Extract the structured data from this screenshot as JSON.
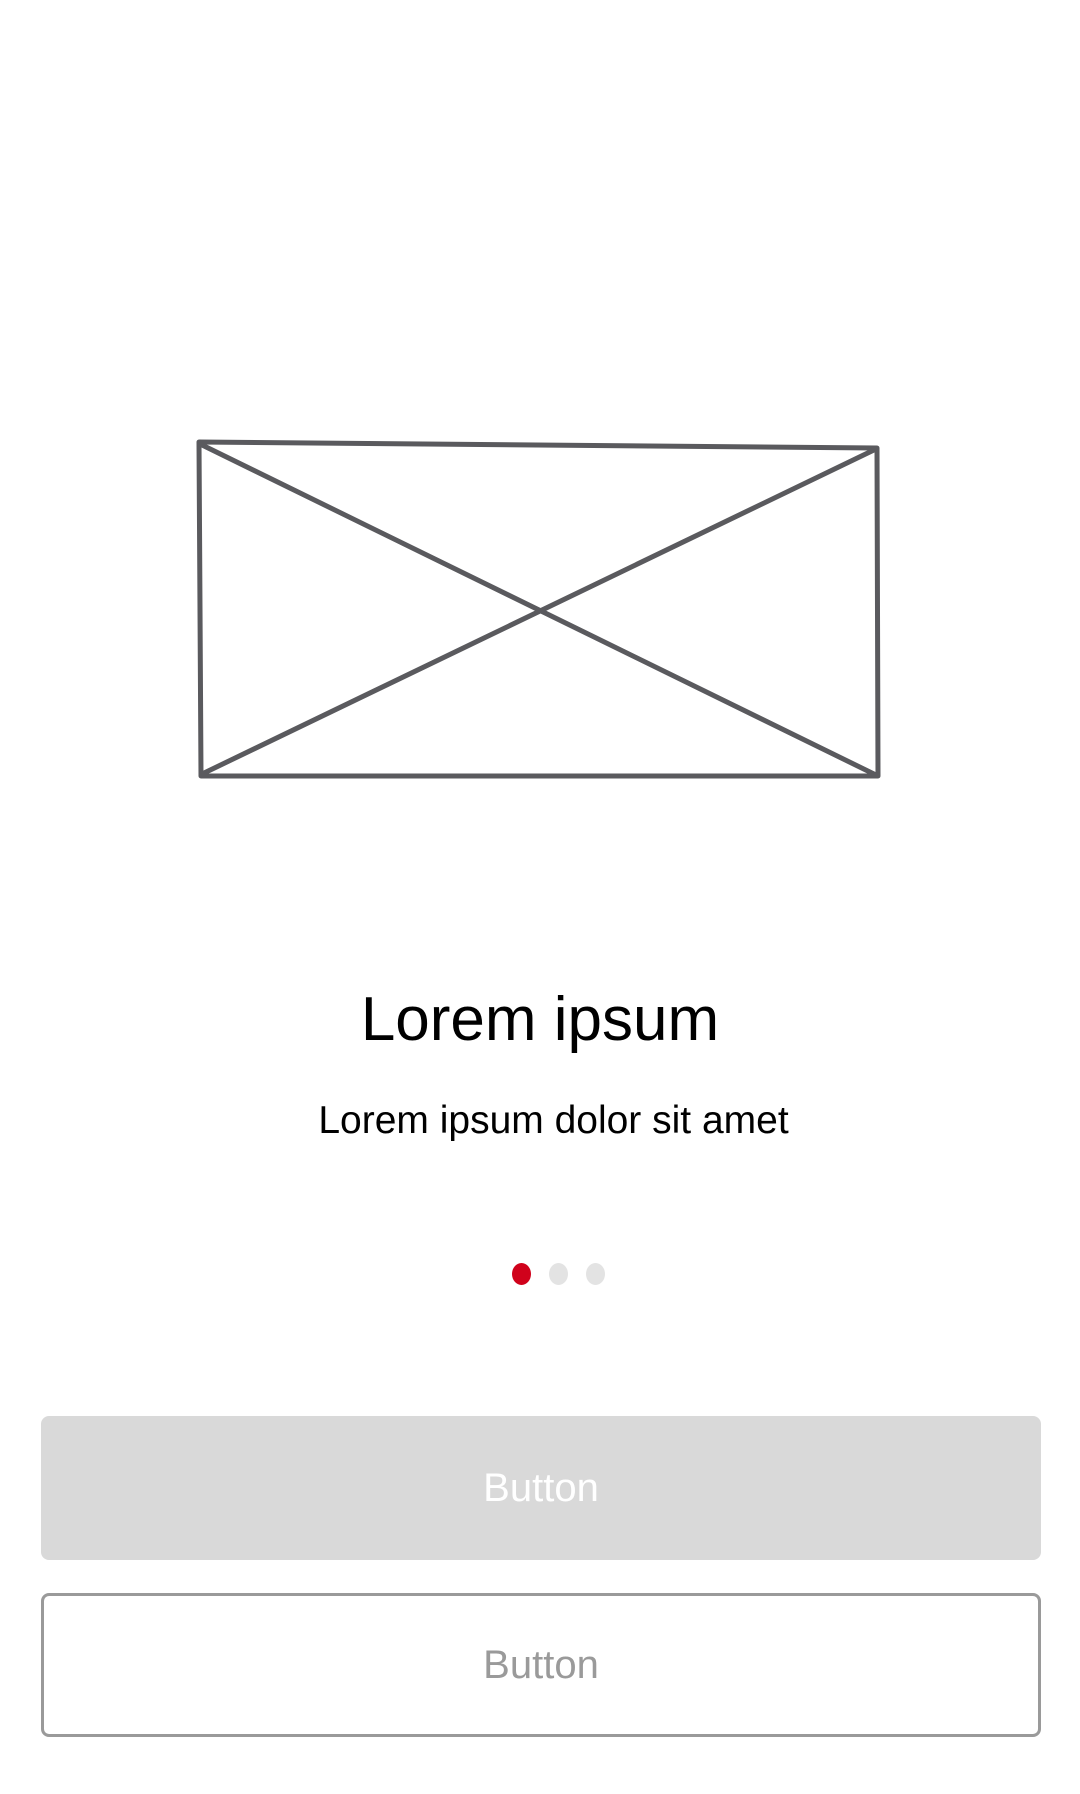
{
  "onboarding": {
    "title": "Lorem ipsum",
    "subtitle": "Lorem ipsum dolor sit amet"
  },
  "pager": {
    "current_page": 1,
    "dots": [
      {
        "color": "#d0021b"
      },
      {
        "color": "#e3e3e3"
      },
      {
        "color": "#e3e3e3"
      }
    ]
  },
  "buttons": {
    "primary_label": "Button",
    "secondary_label": "Button"
  },
  "colors": {
    "accent": "#d0021b",
    "button_fill": "#d9d9d9",
    "button_outline": "#9a9a9a"
  },
  "icons": {
    "image_placeholder": "image-placeholder-icon"
  }
}
